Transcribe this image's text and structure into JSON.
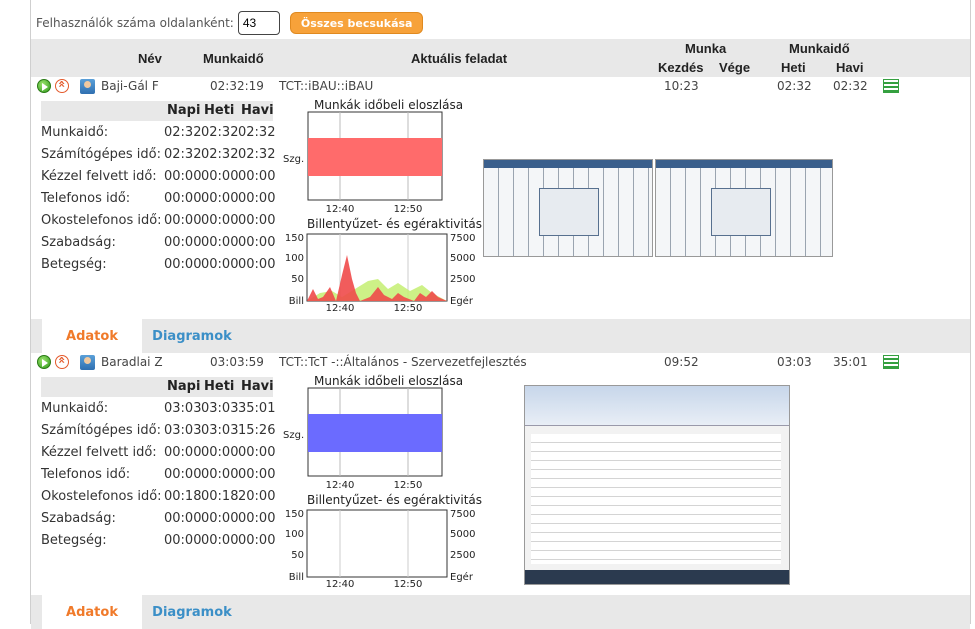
{
  "toolbar": {
    "per_page_label": "Felhasználók száma oldalanként:",
    "per_page_value": "43",
    "collapse_all_label": "Összes becsukása",
    "accent": "#f7a23a"
  },
  "header": {
    "nev": "Név",
    "munkaido": "Munkaidő",
    "aktualis_feladat": "Aktuális feladat",
    "munka": "Munka",
    "kezdes": "Kezdés",
    "vege": "Vége",
    "munkaido2": "Munkaidő",
    "heti": "Heti",
    "havi": "Havi"
  },
  "stat_headers": {
    "napi": "Napi",
    "heti": "Heti",
    "havi": "Havi"
  },
  "stat_labels": [
    "Munkaidő:",
    "Számítógépes idő:",
    "Kézzel felvett idő:",
    "Telefonos idő:",
    "Okostelefonos idő:",
    "Szabadság:",
    "Betegség:"
  ],
  "charts": {
    "dist_title": "Munkák időbeli eloszlása",
    "act_title": "Billentyűzet- és egéraktivitás",
    "dist_ylabel": "Szg.",
    "x_ticks": [
      "12:40",
      "12:50"
    ],
    "left_ticks": [
      "150",
      "100",
      "50",
      "Bill"
    ],
    "right_ticks": [
      "7500",
      "5000",
      "2500",
      "Egér"
    ]
  },
  "tabs": {
    "adatok": "Adatok",
    "diagramok": "Diagramok"
  },
  "users": [
    {
      "name": "Baji-Gál F",
      "worktime": "02:32:19",
      "task": "TCT::iBAU::iBAU",
      "start": "10:23",
      "end": "",
      "weekly": "02:32",
      "monthly": "02:32",
      "stats": [
        [
          "02:32",
          "02:32",
          "02:32"
        ],
        [
          "02:32",
          "02:32",
          "02:32"
        ],
        [
          "00:00",
          "00:00",
          "00:00"
        ],
        [
          "00:00",
          "00:00",
          "00:00"
        ],
        [
          "00:00",
          "00:00",
          "00:00"
        ],
        [
          "00:00",
          "00:00",
          "00:00"
        ],
        [
          "00:00",
          "00:00",
          "00:00"
        ]
      ],
      "dist_color": "#ff6b6b",
      "activity": true
    },
    {
      "name": "Baradlai Z",
      "worktime": "03:03:59",
      "task": "TCT::TcT -::Általános - Szervezetfejlesztés",
      "start": "09:52",
      "end": "",
      "weekly": "03:03",
      "monthly": "35:01",
      "stats": [
        [
          "03:03",
          "03:03",
          "35:01"
        ],
        [
          "03:03",
          "03:03",
          "15:26"
        ],
        [
          "00:00",
          "00:00",
          "00:00"
        ],
        [
          "00:00",
          "00:00",
          "00:00"
        ],
        [
          "00:18",
          "00:18",
          "20:00"
        ],
        [
          "00:00",
          "00:00",
          "00:00"
        ],
        [
          "00:00",
          "00:00",
          "00:00"
        ]
      ],
      "dist_color": "#6b6bff",
      "activity": false
    }
  ]
}
